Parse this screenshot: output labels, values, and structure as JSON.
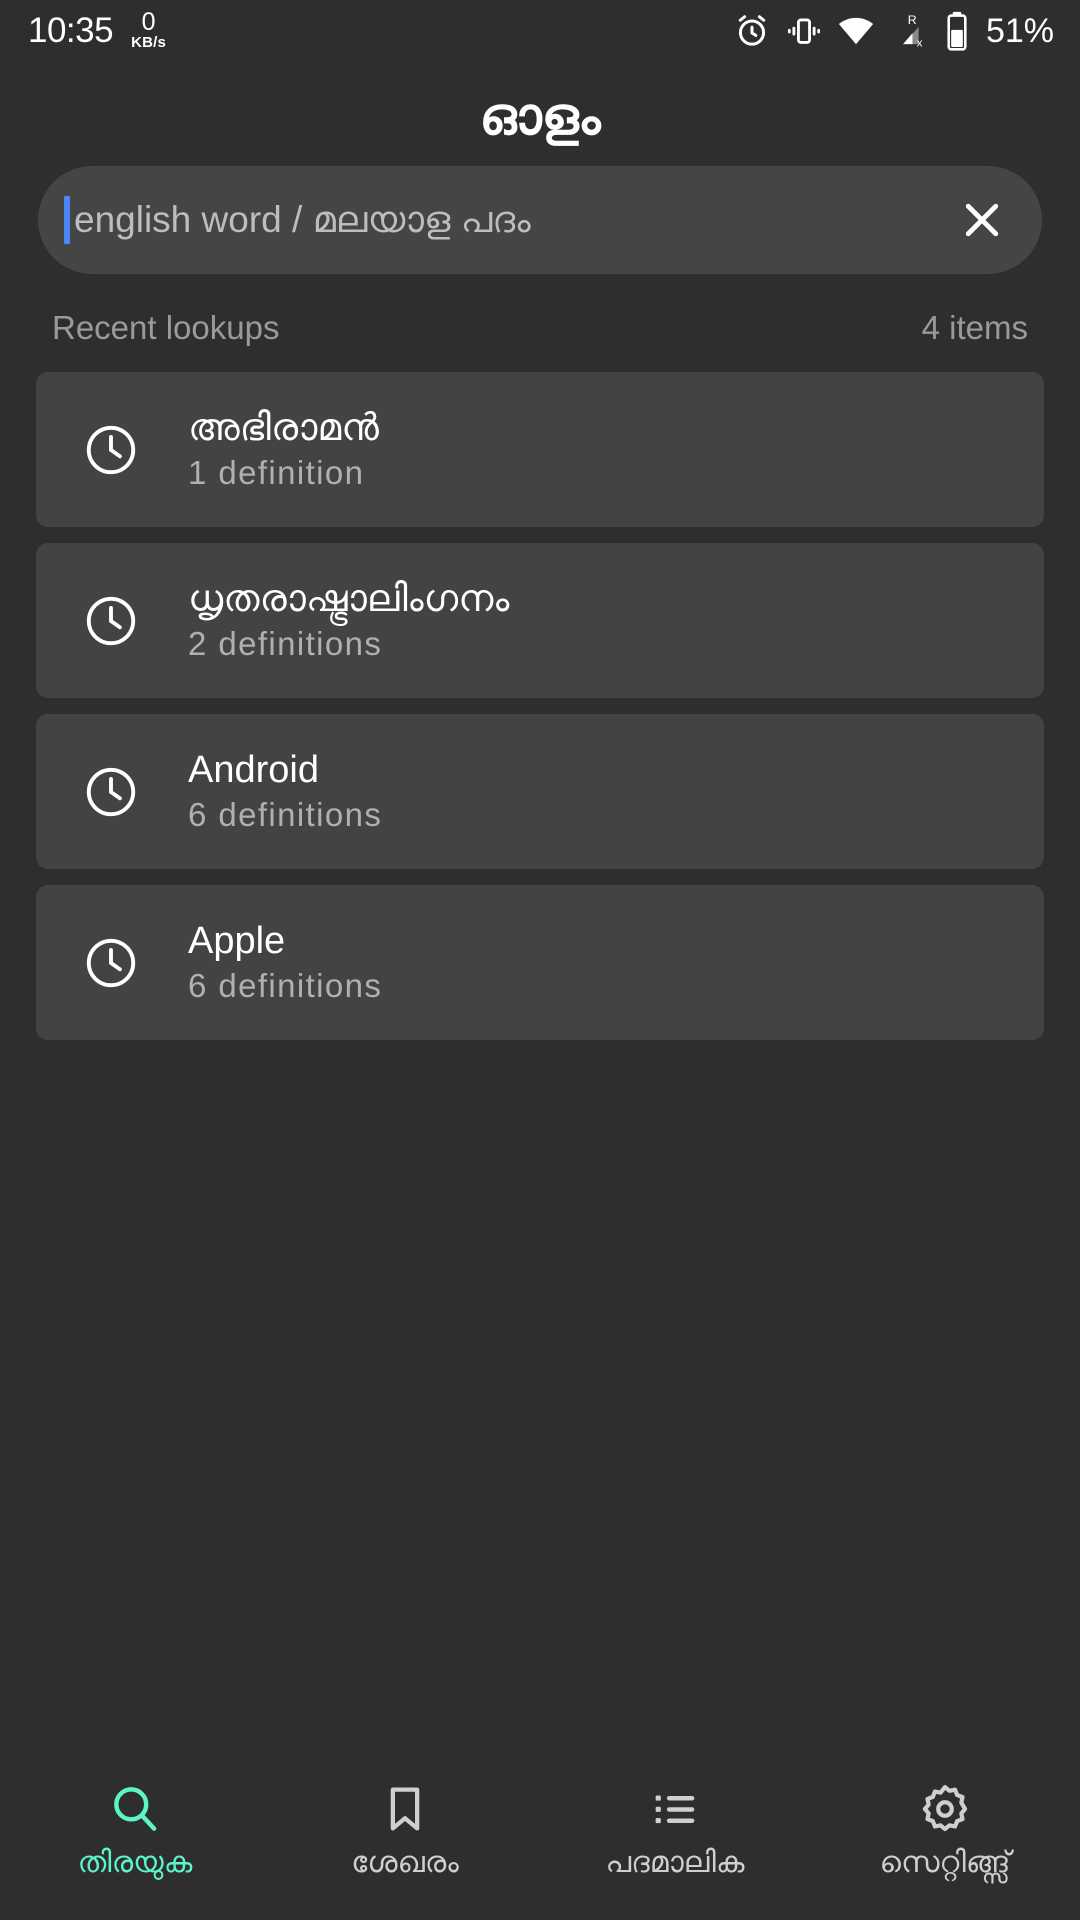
{
  "status_bar": {
    "time": "10:35",
    "net_speed_value": "0",
    "net_speed_unit": "KB/s",
    "icons": [
      "alarm-icon",
      "vibrate-icon",
      "wifi-icon",
      "cellular-roaming-no-sim-icon",
      "battery-icon"
    ],
    "battery_percent": "51%",
    "roaming_label": "R"
  },
  "header": {
    "app_title": "ഓളം"
  },
  "search": {
    "value": "",
    "placeholder": "english word / മലയാള പദം",
    "clear_icon": "close-icon",
    "caret_color": "#4a86f7"
  },
  "recent": {
    "section_label": "Recent lookups",
    "count_label": "4 items",
    "items": [
      {
        "icon": "clock-icon",
        "word": "അഭിരാമൻ",
        "definitions": "1 definition"
      },
      {
        "icon": "clock-icon",
        "word": "ധൃതരാഷ്ട്രാലിംഗനം",
        "definitions": "2 definitions"
      },
      {
        "icon": "clock-icon",
        "word": "Android",
        "definitions": "6 definitions"
      },
      {
        "icon": "clock-icon",
        "word": "Apple",
        "definitions": "6 definitions"
      }
    ]
  },
  "bottom_nav": {
    "active_color": "#5cf5c8",
    "inactive_color": "#cfcfcf",
    "items": [
      {
        "label": "തിരയുക",
        "icon": "search-icon",
        "active": true
      },
      {
        "label": "ശേഖരം",
        "icon": "bookmark-icon",
        "active": false
      },
      {
        "label": "പദമാലിക",
        "icon": "list-icon",
        "active": false
      },
      {
        "label": "സെറ്റിങ്ങ്സ്",
        "icon": "gear-icon",
        "active": false
      }
    ]
  },
  "theme": {
    "background": "#2e2e2e",
    "card_background": "#434343",
    "search_background": "#454545",
    "primary_text": "#ffffff",
    "secondary_text": "#b0b0b0"
  }
}
